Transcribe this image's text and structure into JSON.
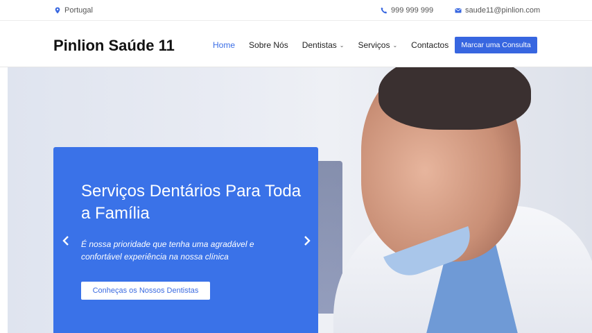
{
  "topbar": {
    "location": "Portugal",
    "phone": "999 999 999",
    "email": "saude11@pinlion.com"
  },
  "navbar": {
    "brand": "Pinlion Saúde 11",
    "menu": [
      {
        "label": "Home",
        "active": true
      },
      {
        "label": "Sobre Nós"
      },
      {
        "label": "Dentistas",
        "dropdown": true
      },
      {
        "label": "Serviços",
        "dropdown": true
      },
      {
        "label": "Contactos"
      }
    ],
    "cta": "Marcar uma Consulta"
  },
  "hero": {
    "title": "Serviços Dentários Para Toda a Família",
    "subtitle": "É nossa prioridade que tenha uma agradável e confortável experiência na nossa clínica",
    "button": "Conheças os Nossos Dentistas"
  },
  "colors": {
    "accent": "#3766e0"
  }
}
